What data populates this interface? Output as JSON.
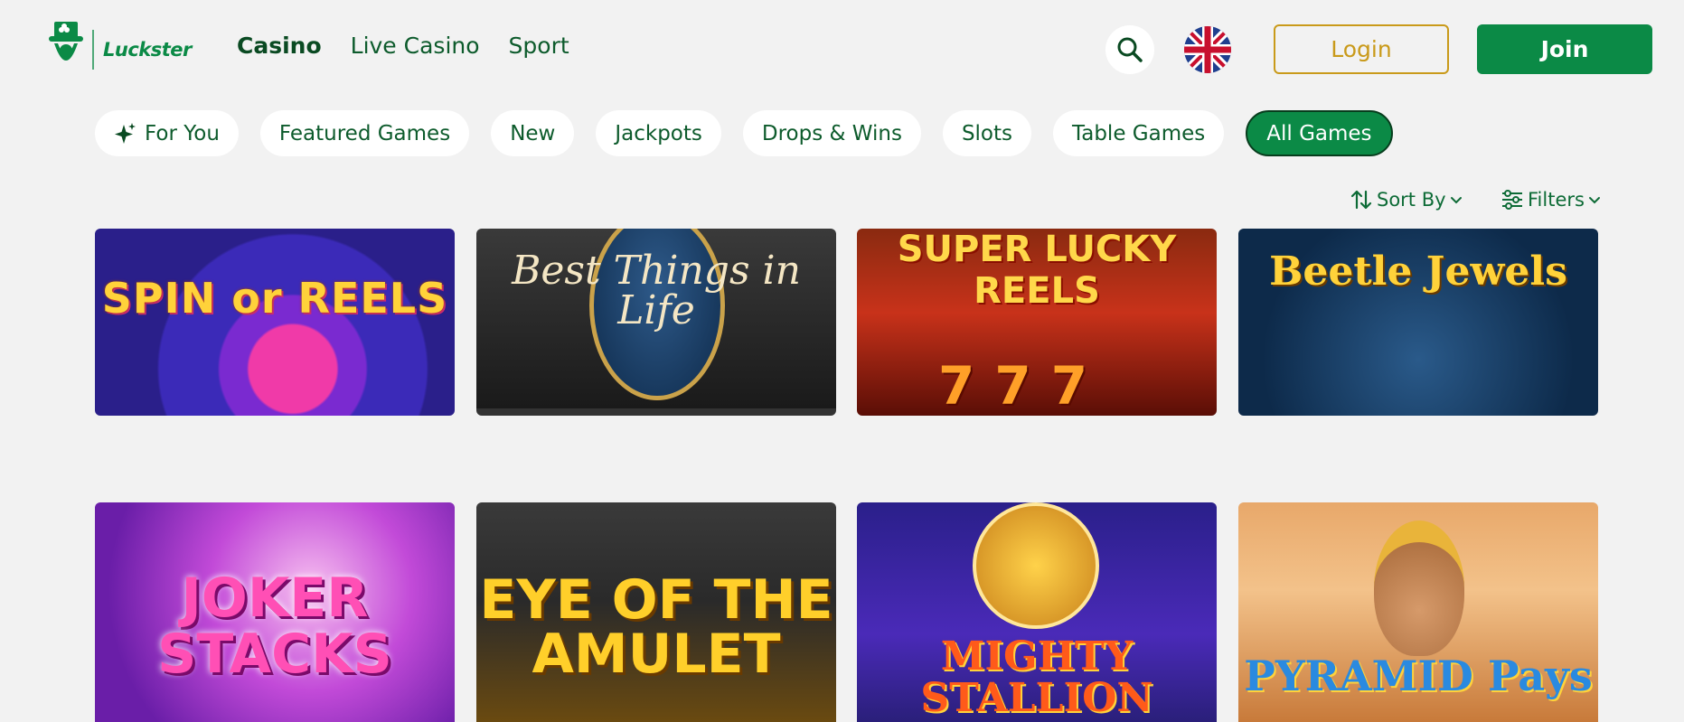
{
  "header": {
    "logo_text": "Luckster",
    "nav": [
      "Casino",
      "Live Casino",
      "Sport"
    ],
    "login_label": "Login",
    "join_label": "Join"
  },
  "categories": {
    "items": [
      "For You",
      "Featured Games",
      "New",
      "Jackpots",
      "Drops & Wins",
      "Slots",
      "Table Games",
      "All Games"
    ],
    "active": "All Games"
  },
  "tools": {
    "sort_label": "Sort By",
    "filters_label": "Filters"
  },
  "games": {
    "row1": [
      "SPIN or REELS",
      "Best Things in Life",
      "SUPER LUCKY REELS",
      "Beetle Jewels"
    ],
    "row2": [
      "JOKER STACKS",
      "EYE OF THE AMULET",
      "MIGHTY STALLION",
      "PYRAMID Pays"
    ]
  },
  "colors": {
    "brand_green": "#0b8a46",
    "login_gold": "#c99a1a",
    "background": "#f2f2f2"
  }
}
